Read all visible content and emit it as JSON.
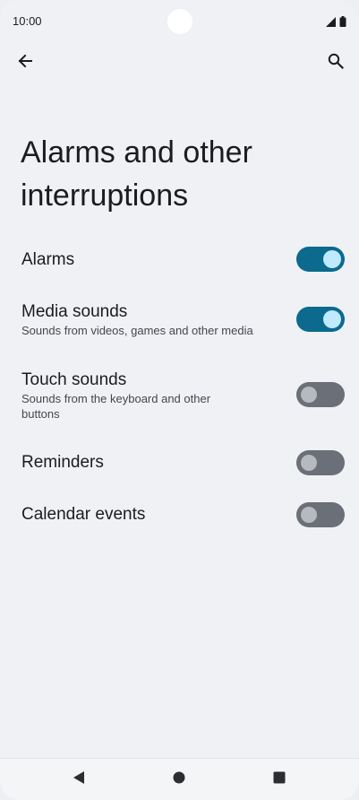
{
  "status_bar": {
    "time": "10:00",
    "icons": [
      "signal-icon",
      "battery-icon"
    ]
  },
  "app_bar": {
    "back_icon": "arrow-back-icon",
    "search_icon": "search-icon"
  },
  "page": {
    "title": "Alarms and other interruptions"
  },
  "settings": [
    {
      "label": "Alarms",
      "summary": "",
      "state": "on"
    },
    {
      "label": "Media sounds",
      "summary": "Sounds from videos, games and other media",
      "state": "on"
    },
    {
      "label": "Touch sounds",
      "summary": "Sounds from the keyboard and other buttons",
      "state": "off"
    },
    {
      "label": "Reminders",
      "summary": "",
      "state": "off"
    },
    {
      "label": "Calendar events",
      "summary": "",
      "state": "off"
    }
  ],
  "nav_bar": {
    "icons": [
      "back-triangle-icon",
      "home-circle-icon",
      "recents-square-icon"
    ]
  },
  "colors": {
    "background": "#f0f1f4",
    "toggle_on": "#0b6a8e",
    "toggle_on_knob": "#bfe9ff",
    "toggle_off": "#6b6f77",
    "toggle_off_knob": "#b6b9c0"
  }
}
